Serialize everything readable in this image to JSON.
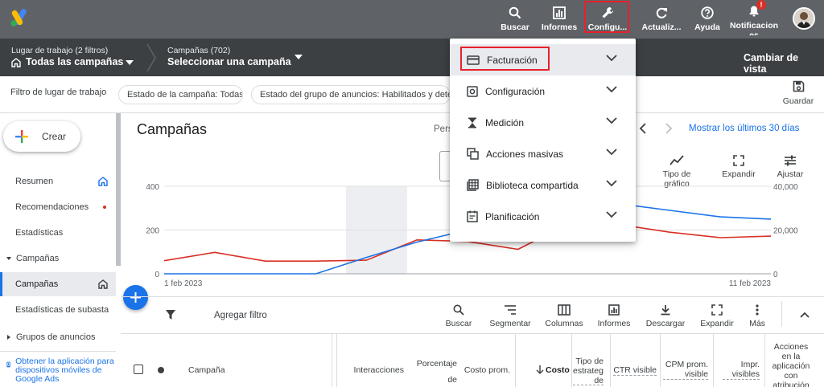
{
  "topbar": {
    "search": "Buscar",
    "reports": "Informes",
    "tools": "Configu...",
    "refresh": "Actualiz...",
    "help": "Ayuda",
    "notifications": "Notificacion\nes",
    "notif_badge": "!"
  },
  "crumbs": {
    "workspace_small": "Lugar de trabajo (2 filtros)",
    "workspace_big": "Todas las campañas",
    "campaigns_small": "Campañas (702)",
    "campaigns_big": "Seleccionar una campaña",
    "switch_view": "Cambiar de vista"
  },
  "filterbar": {
    "label": "Filtro de lugar de trabajo",
    "chip1": "Estado de la campaña: Todas",
    "chip2": "Estado del grupo de anuncios: Habilitados y deteni",
    "save": "Guardar"
  },
  "sidebar": {
    "create": "Crear",
    "items": [
      {
        "label": "Resumen"
      },
      {
        "label": "Recomendaciones"
      },
      {
        "label": "Estadísticas"
      },
      {
        "label": "Campañas"
      },
      {
        "label": "Campañas"
      },
      {
        "label": "Estadísticas de subasta"
      },
      {
        "label": "Grupos de anuncios"
      }
    ],
    "app_promo": "Obtener la aplicación para dispositivos móviles de Google Ads"
  },
  "main": {
    "title": "Campañas",
    "persp_label": "Pers",
    "date_range": "Mostrar los últimos 30 días",
    "chart_tools": {
      "chart_type": "Tipo de gráfico",
      "expand": "Expandir",
      "adjust": "Ajustar"
    },
    "table_tools": {
      "add_filter": "Agregar filtro",
      "search": "Buscar",
      "segment": "Segmentar",
      "columns": "Columnas",
      "reports": "Informes",
      "download": "Descargar",
      "expand": "Expandir",
      "more": "Más"
    },
    "columns": {
      "campaign": "Campaña",
      "interactions": "Interacciones",
      "interaction_rate": "Porcentaje de interacciones",
      "avg_cost": "Costo prom.",
      "cost": "Costo",
      "bid_strategy": "Tipo de estrategia de ofertas",
      "ctr_visible": "CTR visible",
      "cpm_visible": "CPM prom. visible",
      "impr_visible": "Impr. visibles",
      "actions": "Acciones en la aplicación con atribución"
    }
  },
  "menu": {
    "items": [
      {
        "label": "Facturación",
        "icon": "credit-card-icon"
      },
      {
        "label": "Configuración",
        "icon": "settings-icon"
      },
      {
        "label": "Medición",
        "icon": "hourglass-icon"
      },
      {
        "label": "Acciones masivas",
        "icon": "copy-icon"
      },
      {
        "label": "Biblioteca compartida",
        "icon": "library-grid-icon"
      },
      {
        "label": "Planificación",
        "icon": "calendar-icon"
      }
    ]
  },
  "chart_data": {
    "type": "line",
    "x_labels": [
      "1 feb 2023",
      "11 feb 2023"
    ],
    "y_left_ticks": [
      0,
      200,
      400
    ],
    "y_right_ticks": [
      "0",
      "20,000",
      "40,000"
    ],
    "y_left_lim": [
      0,
      400
    ],
    "y_right_lim": [
      0,
      40000
    ],
    "series": [
      {
        "color": "#d93025",
        "axis": "left",
        "values": [
          60,
          98,
          58,
          58,
          62,
          155,
          148,
          112,
          230,
          225,
          190,
          165,
          172
        ]
      },
      {
        "color": "#1a73e8",
        "axis": "right",
        "values": [
          0,
          0,
          0,
          0,
          7500,
          14500,
          20000,
          22000,
          30000,
          32000,
          29000,
          26000,
          25000
        ]
      }
    ],
    "colors": {
      "red": "#d93025",
      "blue": "#1a73e8"
    }
  }
}
